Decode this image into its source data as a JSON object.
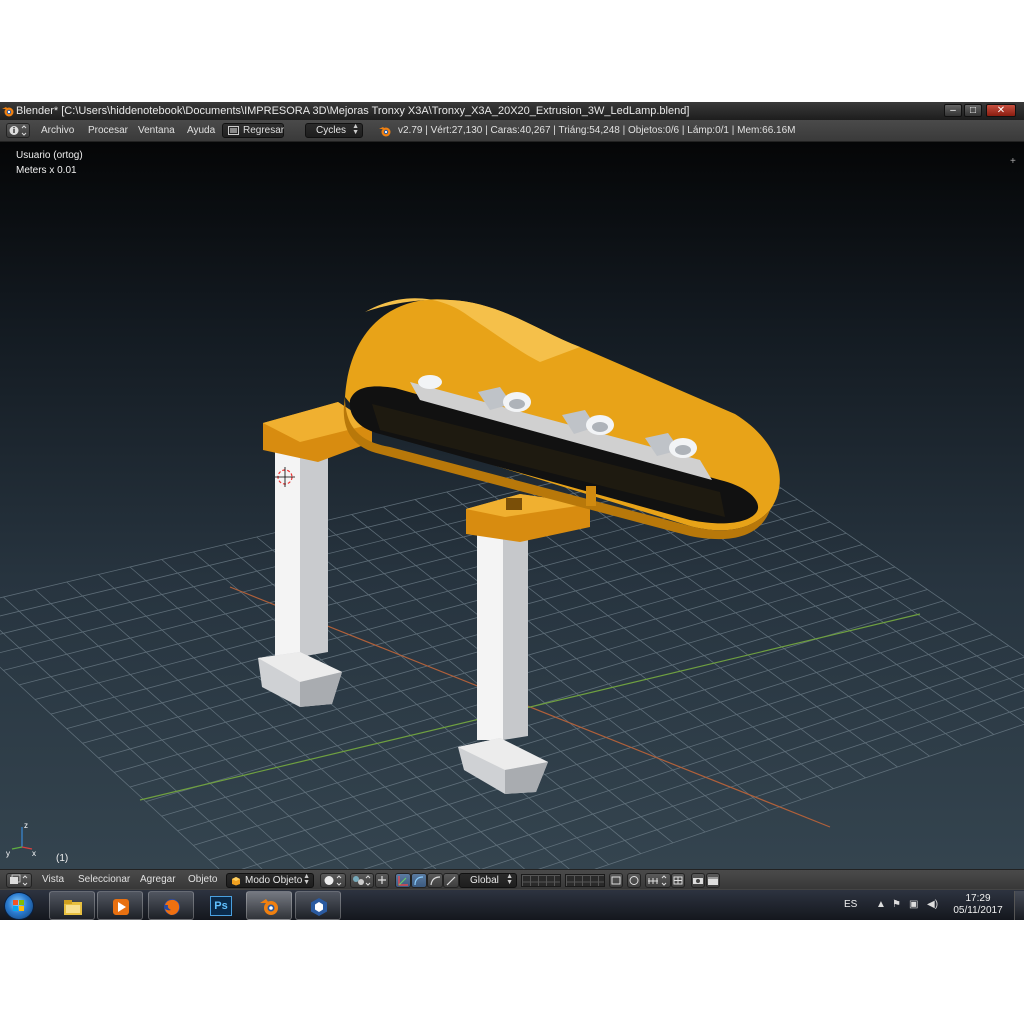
{
  "window": {
    "title": "Blender* [C:\\Users\\hiddenotebook\\Documents\\IMPRESORA 3D\\Mejoras Tronxy X3A\\Tronxy_X3A_20X20_Extrusion_3W_LedLamp.blend]",
    "controls": [
      "minimize",
      "maximize",
      "close"
    ]
  },
  "info_header": {
    "menus": [
      "Archivo",
      "Procesar",
      "Ventana",
      "Ayuda"
    ],
    "back_button": "Regresar",
    "render_engine": "Cycles",
    "stats": "v2.79 | Vért:27,130 | Caras:40,267 | Triáng:54,248 | Objetos:0/6 | Lámp:0/1 | Mem:66.16M"
  },
  "viewport": {
    "view_name": "Usuario (ortog)",
    "units": "Meters x 0.01",
    "frame": "(1)",
    "colors": {
      "lamp_shade": "#e8a318",
      "supports": "#dcdcdc",
      "grid": "#6f7f8a",
      "x_axis": "#b0603a",
      "y_axis": "#6fa040"
    }
  },
  "view_header": {
    "menus": [
      "Vista",
      "Seleccionar",
      "Agregar",
      "Objeto"
    ],
    "mode": "Modo Objeto",
    "orientation": "Global"
  },
  "taskbar": {
    "apps": [
      "Windows Explorer",
      "Media Player",
      "Firefox",
      "Photoshop",
      "Blender",
      "Cura"
    ],
    "photoshop_label": "Ps",
    "language": "ES",
    "time": "17:29",
    "date": "05/11/2017"
  }
}
